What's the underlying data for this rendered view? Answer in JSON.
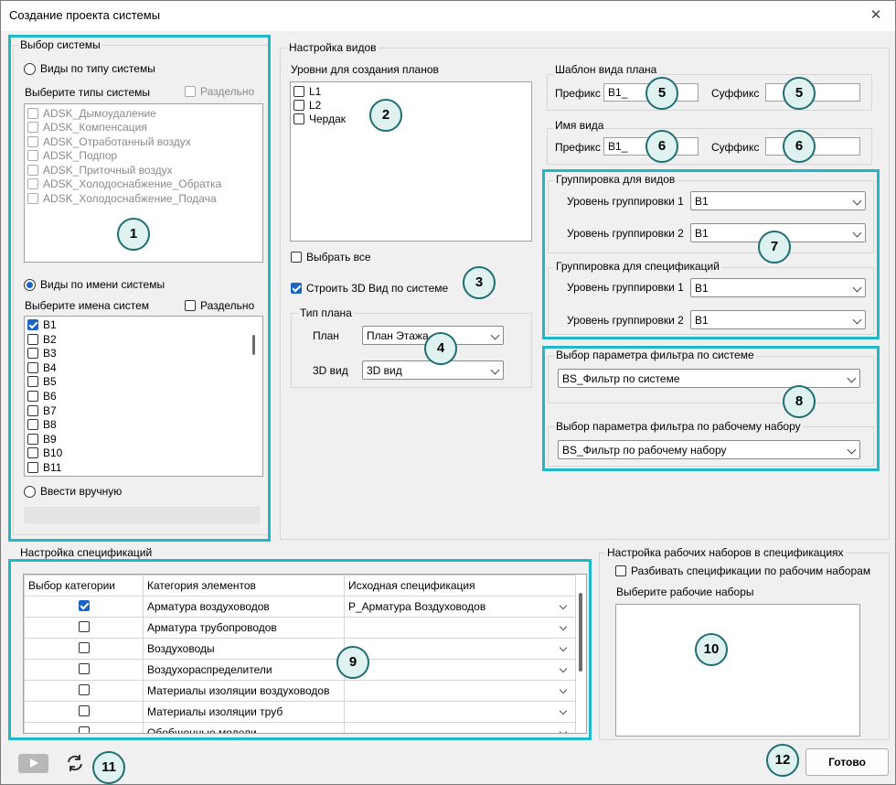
{
  "window": {
    "title": "Создание проекта системы",
    "close": "✕"
  },
  "system_select": {
    "title": "Выбор системы",
    "by_type": {
      "label": "Виды по типу системы",
      "list_label": "Выберите типы системы",
      "separate": "Раздельно",
      "items": [
        "ADSK_Дымоудаление",
        "ADSK_Компенсация",
        "ADSK_Отработанный воздух",
        "ADSK_Подпор",
        "ADSK_Приточный воздух",
        "ADSK_Холодоснабжение_Обратка",
        "ADSK_Холодоснабжение_Подача"
      ]
    },
    "by_name": {
      "label": "Виды по имени системы",
      "list_label": "Выберите имена систем",
      "separate": "Раздельно",
      "items": [
        "B1",
        "B2",
        "B3",
        "B4",
        "B5",
        "B6",
        "B7",
        "B8",
        "B9",
        "B10",
        "B11"
      ]
    },
    "manual": "Ввести вручную"
  },
  "view_settings": {
    "title": "Настройка видов",
    "levels_label": "Уровни для создания планов",
    "levels": [
      "L1",
      "L2",
      "Чердак"
    ],
    "select_all": "Выбрать все",
    "build_3d": "Строить 3D Вид по системе",
    "plan_type": {
      "title": "Тип плана",
      "plan_label": "План",
      "plan_value": "План Этажа",
      "view3d_label": "3D вид",
      "view3d_value": "3D вид"
    },
    "template": {
      "title": "Шаблон вида плана",
      "prefix_label": "Префикс",
      "prefix_value": "B1_",
      "suffix_label": "Суффикс",
      "suffix_value": ""
    },
    "view_name": {
      "title": "Имя вида",
      "prefix_label": "Префикс",
      "prefix_value": "B1_",
      "suffix_label": "Суффикс",
      "suffix_value": ""
    },
    "grouping_views": {
      "title": "Группировка для видов",
      "level1_label": "Уровень группировки 1",
      "level1_value": "B1",
      "level2_label": "Уровень группировки 2",
      "level2_value": "B1"
    },
    "grouping_specs": {
      "title": "Группировка для спецификаций",
      "level1_label": "Уровень группировки 1",
      "level1_value": "B1",
      "level2_label": "Уровень группировки 2",
      "level2_value": "B1"
    },
    "filter_system": {
      "title": "Выбор параметра фильтра по системе",
      "value": "BS_Фильтр по системе"
    },
    "filter_workset": {
      "title": "Выбор параметра фильтра по рабочему набору",
      "value": "BS_Фильтр по рабочему набору"
    }
  },
  "spec_settings": {
    "title": "Настройка спецификаций",
    "columns": [
      "Выбор категории",
      "Категория элементов",
      "Исходная спецификация"
    ],
    "rows": [
      {
        "checked": true,
        "category": "Арматура воздуховодов",
        "spec": "P_Арматура Воздуховодов"
      },
      {
        "checked": false,
        "category": "Арматура трубопроводов",
        "spec": ""
      },
      {
        "checked": false,
        "category": "Воздуховоды",
        "spec": ""
      },
      {
        "checked": false,
        "category": "Воздухораспределители",
        "spec": ""
      },
      {
        "checked": false,
        "category": "Материалы изоляции воздуховодов",
        "spec": ""
      },
      {
        "checked": false,
        "category": "Материалы изоляции труб",
        "spec": ""
      },
      {
        "checked": false,
        "category": "Обобщенные модели",
        "spec": ""
      }
    ]
  },
  "workset_settings": {
    "title": "Настройка рабочих наборов в спецификациях",
    "split_label": "Разбивать спецификации по рабочим наборам",
    "list_label": "Выберите рабочие наборы"
  },
  "footer": {
    "done_label": "Готово"
  },
  "callouts": [
    "1",
    "2",
    "3",
    "4",
    "5",
    "5",
    "6",
    "6",
    "7",
    "8",
    "9",
    "10",
    "11",
    "12"
  ],
  "colors": {
    "highlight": "#1eb8c8",
    "accent": "#1a64c8",
    "callout_fill": "#dff2ef",
    "callout_border": "#1f6e73"
  }
}
